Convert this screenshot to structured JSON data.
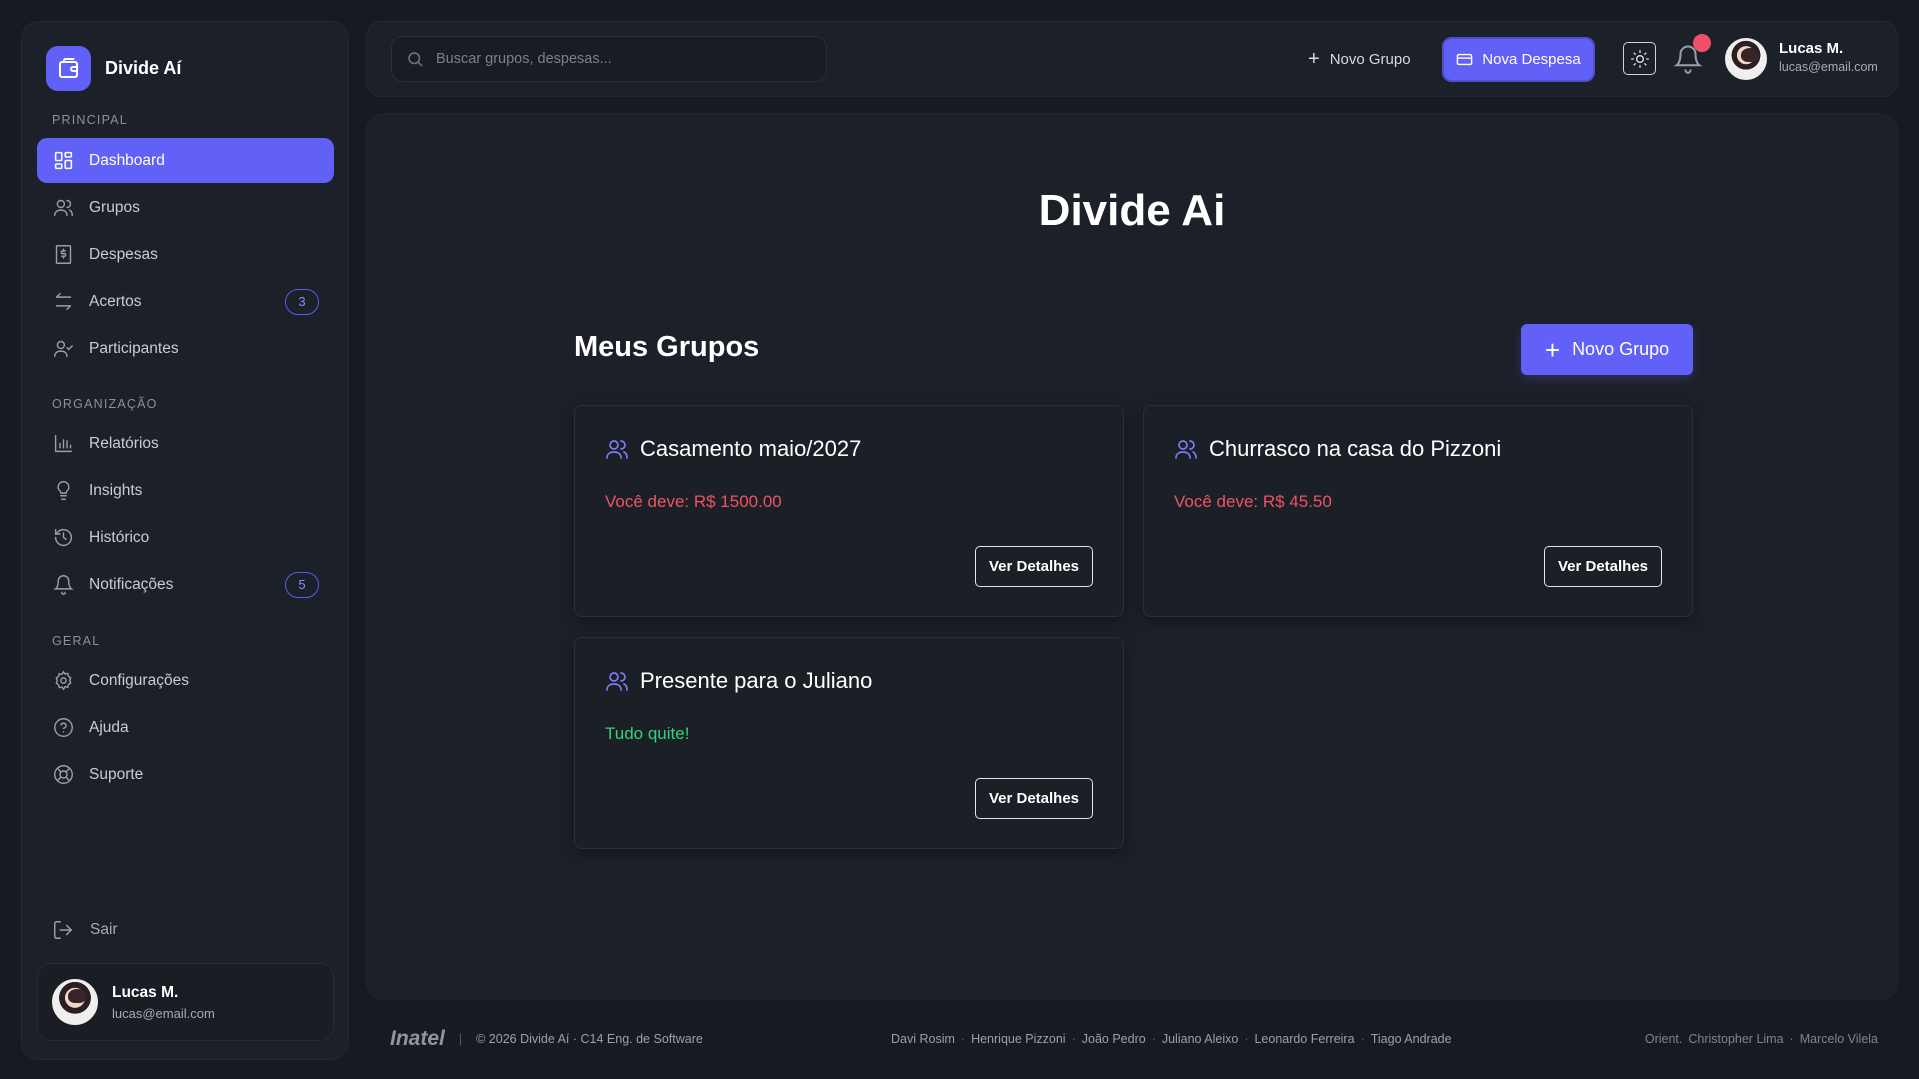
{
  "app": {
    "name": "Divide Aí"
  },
  "sidebar": {
    "sections": {
      "principal": "PRINCIPAL",
      "organizacao": "ORGANIZAÇÃO",
      "geral": "GERAL"
    },
    "items": [
      {
        "label": "Dashboard",
        "icon": "dashboard-icon",
        "active": true
      },
      {
        "label": "Grupos",
        "icon": "users-icon"
      },
      {
        "label": "Despesas",
        "icon": "receipt-icon"
      },
      {
        "label": "Acertos",
        "icon": "swap-icon",
        "badge": "3"
      },
      {
        "label": "Participantes",
        "icon": "user-check-icon"
      },
      {
        "label": "Relatórios",
        "icon": "bar-chart-icon"
      },
      {
        "label": "Insights",
        "icon": "lightbulb-icon"
      },
      {
        "label": "Histórico",
        "icon": "history-icon"
      },
      {
        "label": "Notificações",
        "icon": "bell-icon",
        "badge": "5"
      },
      {
        "label": "Configurações",
        "icon": "gear-icon"
      },
      {
        "label": "Ajuda",
        "icon": "help-icon"
      },
      {
        "label": "Suporte",
        "icon": "lifebuoy-icon"
      }
    ],
    "logout": "Sair",
    "user": {
      "name": "Lucas M.",
      "email": "lucas@email.com"
    }
  },
  "topbar": {
    "search_placeholder": "Buscar grupos, despesas...",
    "new_group": "Novo Grupo",
    "new_expense": "Nova Despesa",
    "user": {
      "name": "Lucas M.",
      "email": "lucas@email.com"
    }
  },
  "main": {
    "title": "Divide Ai",
    "groups_heading": "Meus Grupos",
    "new_group_button": "Novo Grupo",
    "groups": [
      {
        "name": "Casamento maio/2027",
        "status": "Você deve: R$ 1500.00",
        "status_type": "debt",
        "button": "Ver Detalhes"
      },
      {
        "name": "Churrasco na casa do Pizzoni",
        "status": "Você deve: R$ 45.50",
        "status_type": "debt",
        "button": "Ver Detalhes"
      },
      {
        "name": "Presente para o Juliano",
        "status": "Tudo quite!",
        "status_type": "ok",
        "button": "Ver Detalhes"
      }
    ]
  },
  "footer": {
    "institution": "Inatel",
    "copyright": "© 2026 Divide Aí · C14 Eng. de Software",
    "authors": [
      "Davi Rosim",
      "Henrique Pizzoni",
      "João Pedro",
      "Juliano Aleixo",
      "Leonardo Ferreira",
      "Tiago Andrade"
    ],
    "orient_label": "Orient.",
    "advisors": [
      "Christopher Lima",
      "Marcelo Vilela"
    ]
  },
  "colors": {
    "accent": "#6160f7",
    "debt": "#f05266",
    "ok": "#36d07a",
    "background": "#171a20",
    "panel": "#1c2028"
  }
}
